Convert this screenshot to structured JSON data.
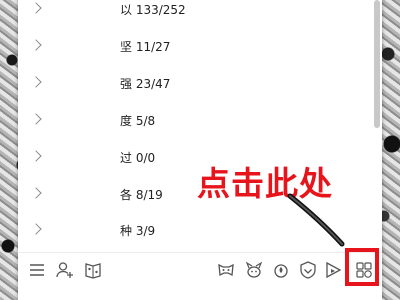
{
  "list": {
    "rows": [
      {
        "text": "以 133/252"
      },
      {
        "text": "坚 11/27"
      },
      {
        "text": "强 23/47"
      },
      {
        "text": "度 5/8"
      },
      {
        "text": "过 0/0"
      },
      {
        "text": "各 8/19"
      },
      {
        "text": "种 3/9"
      }
    ]
  },
  "toolbar": {
    "left_icons": [
      "menu-icon",
      "add-user-icon",
      "book-icon"
    ],
    "right_icons": [
      "game-controller-icon",
      "pet-icon",
      "fire-icon",
      "shield-icon",
      "play-icon",
      "apps-grid-icon"
    ]
  },
  "annotation": {
    "text": "点击此处",
    "color": "#e8141c"
  }
}
